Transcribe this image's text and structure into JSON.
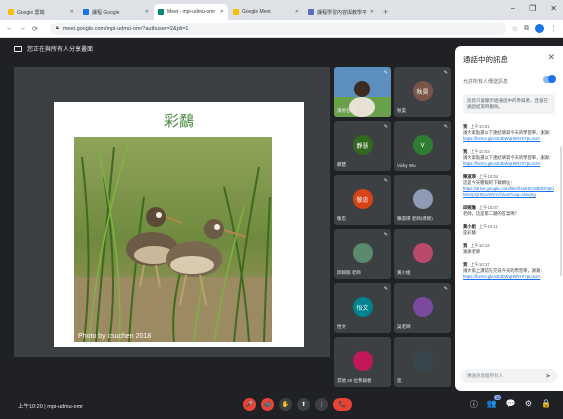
{
  "browser": {
    "tabs": [
      {
        "title": "Google 雲端",
        "favicon_color": "#fbbc04",
        "active": false
      },
      {
        "title": "課程 Google",
        "favicon_color": "#1a73e8",
        "active": false
      },
      {
        "title": "Meet - mpi-udmu-omr",
        "favicon_color": "#00897b",
        "active": true
      },
      {
        "title": "Google Meet",
        "favicon_color": "#fbbc04",
        "active": false
      },
      {
        "title": "課程學習內容與教學平台",
        "favicon_color": "#5c6bc0",
        "active": false
      }
    ],
    "new_tab": "+",
    "window_controls": [
      "−",
      "❐",
      "✕"
    ],
    "url": "meet.google.com/mpi-udmu-omr?authuser=2&pli=1",
    "nav": [
      "←",
      "→",
      "⟳"
    ]
  },
  "meet": {
    "presenting_label": "您正在與所有人分享畫面",
    "slide": {
      "title": "彩鷸",
      "credit": "Photo by csuchen 2018"
    },
    "tiles": [
      {
        "name": "講者名稱",
        "kind": "video",
        "initial": "",
        "color": "#4a7aa8",
        "pinned": true
      },
      {
        "name": "秋昊",
        "kind": "initial",
        "initial": "秋昊",
        "color": "#795548",
        "pinned": true
      },
      {
        "name": "靜慧",
        "kind": "initial",
        "initial": "靜慧",
        "color": "#33691e",
        "pinned": true
      },
      {
        "name": "Vicky Wu",
        "kind": "initial",
        "initial": "V",
        "color": "#2e7d32",
        "pinned": true
      },
      {
        "name": "敬忠",
        "kind": "initial",
        "initial": "敬忠",
        "color": "#d84315",
        "pinned": true
      },
      {
        "name": "陳淑瑛 老師(導師)",
        "kind": "avatar",
        "initial": "",
        "color": "#8e9bb4",
        "pinned": false
      },
      {
        "name": "邱婉瑜 老師",
        "kind": "avatar",
        "initial": "",
        "color": "#5b8a6e",
        "pinned": true
      },
      {
        "name": "黃小姐",
        "kind": "avatar",
        "initial": "",
        "color": "#b94a6c",
        "pinned": false
      },
      {
        "name": "怡文",
        "kind": "initial",
        "initial": "怡文",
        "color": "#00838f",
        "pinned": true
      },
      {
        "name": "吳老師",
        "kind": "avatar",
        "initial": "",
        "color": "#7b4a9e",
        "pinned": true
      },
      {
        "name": "其他 20 位參與者",
        "kind": "group",
        "initial": "",
        "color": "#c2185b",
        "pinned": false
      },
      {
        "name": "您",
        "kind": "self",
        "initial": "",
        "color": "#37474f",
        "pinned": false
      }
    ],
    "info": "上午10:20 | mpi-udmu-omr",
    "controls": [
      "🎤",
      "📹",
      "✋",
      "⬆",
      "⋮",
      "📞"
    ],
    "right_controls": [
      "ⓘ",
      "👥",
      "💬",
      "⚙",
      "🔒"
    ],
    "participant_count": "33"
  },
  "chat": {
    "title": "通話中的訊息",
    "close": "✕",
    "toggle_label": "允許所有人傳送訊息",
    "toggle_on": true,
    "notice": "訊息只會顯示給通話中的參與者，且會在通話結束時刪除。",
    "messages": [
      {
        "sender": "我",
        "time": "上午10:01",
        "text": "請大家點選以下連結填寫今天的學習單，謝謝：",
        "link": "https://forms.gle/xE4bWqHkRzX7pLm2A"
      },
      {
        "sender": "我",
        "time": "上午10:03",
        "text": "請大家點選以下連結填寫今天的學習單，謝謝：",
        "link": "https://forms.gle/xE4bWqHkRzX7pLm2A"
      },
      {
        "sender": "陳淑瑛",
        "time": "上午10:04",
        "text": "這是今天簡報的下載網址：",
        "link": "https://drive.google.com/file/d/1aKbC9dEfGhIjKlMnOpQrStUvWxYz/view?usp=sharing"
      },
      {
        "sender": "邱婉瑜",
        "time": "上午10:07",
        "text": "老師，這是第二題的答案嗎？",
        "link": ""
      },
      {
        "sender": "黃小姐",
        "time": "上午10:11",
        "text": "是彩鷸",
        "link": ""
      },
      {
        "sender": "我",
        "time": "上午10:14",
        "text": "謝謝老師",
        "link": ""
      },
      {
        "sender": "我",
        "time": "上午10:17",
        "text": "請大家上課前先完成今天的學習單，謝謝：",
        "link": "https://forms.gle/xE4bWqHkRzX7pLm2A"
      }
    ],
    "composer_placeholder": "傳送訊息給所有人",
    "send": "➤"
  }
}
